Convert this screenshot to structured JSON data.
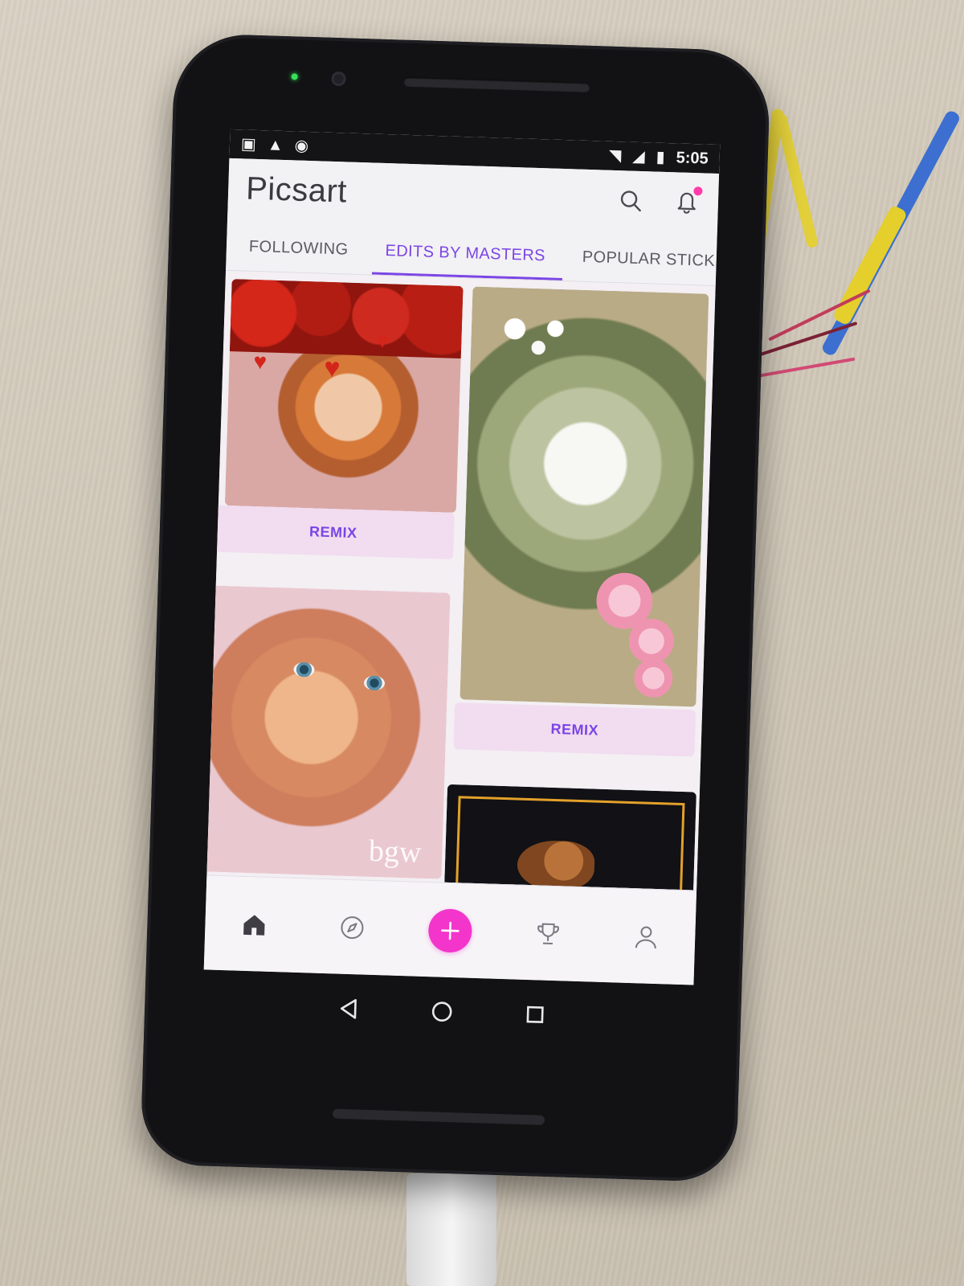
{
  "status_bar": {
    "time": "5:05",
    "left_icons": [
      "app-icon",
      "warning-icon",
      "sync-icon"
    ],
    "right_icons": [
      "wifi-icon",
      "signal-icon",
      "battery-icon"
    ]
  },
  "app_bar": {
    "logo": "Picsart",
    "icons": [
      "search-icon",
      "bell-icon"
    ],
    "notification_badge": true
  },
  "tabs": [
    {
      "label": "FOLLOWING",
      "active": false
    },
    {
      "label": "EDITS BY MASTERS",
      "active": true
    },
    {
      "label": "POPULAR STICK",
      "active": false
    }
  ],
  "feed": {
    "cards": [
      {
        "image": "girl-with-roses-edit",
        "remix_label": "REMIX"
      },
      {
        "image": "tunnel-doves-blossoms-edit",
        "remix_label": "REMIX"
      },
      {
        "image": "baby-in-towel-edit",
        "watermark": "bgw"
      },
      {
        "image": "monkey-framed-edit"
      }
    ]
  },
  "bottom_nav": {
    "items": [
      "home-icon",
      "discover-icon",
      "create-icon",
      "challenges-icon",
      "profile-icon"
    ],
    "active": "home-icon"
  },
  "system_nav": [
    "back-icon",
    "home-circle-icon",
    "recents-icon"
  ],
  "colors": {
    "accent": "#7b45e6",
    "create_button": "#f335cb",
    "remix_button_bg": "#f2dcf0",
    "notification_dot": "#ff3ba8"
  }
}
